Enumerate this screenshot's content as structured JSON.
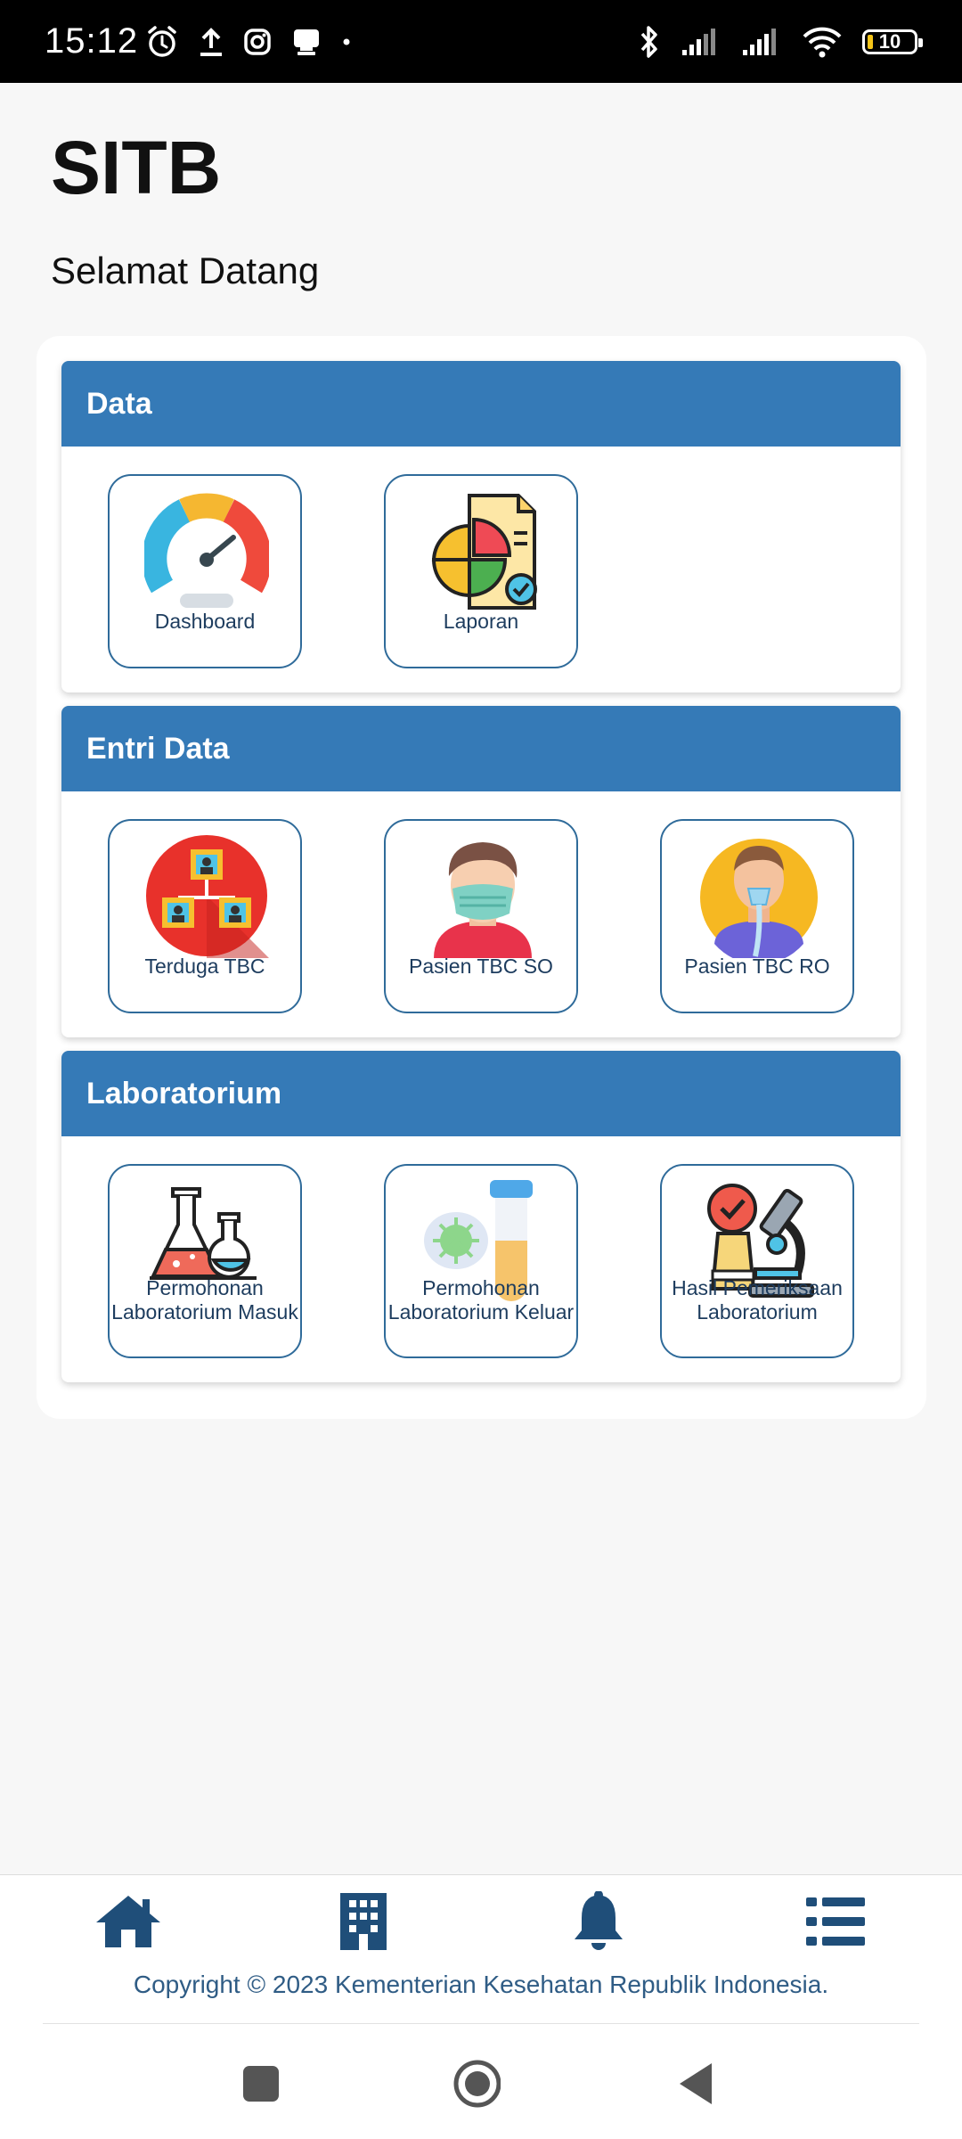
{
  "status_bar": {
    "time": "15:12",
    "battery_level": "10",
    "icons_left": [
      "alarm-icon",
      "upload-icon",
      "instagram-icon",
      "notification-icon",
      "dot-icon"
    ],
    "icons_right": [
      "bluetooth-icon",
      "signal-icon",
      "signal-icon",
      "wifi-icon",
      "battery-icon"
    ]
  },
  "header": {
    "title": "SITB",
    "welcome": "Selamat Datang"
  },
  "sections": [
    {
      "title": "Data",
      "items": [
        {
          "label": "Dashboard",
          "icon": "gauge-icon"
        },
        {
          "label": "Laporan",
          "icon": "report-chart-icon"
        }
      ]
    },
    {
      "title": "Entri Data",
      "items": [
        {
          "label": "Terduga TBC",
          "icon": "suspect-people-icon"
        },
        {
          "label": "Pasien TBC SO",
          "icon": "masked-patient-icon"
        },
        {
          "label": "Pasien TBC RO",
          "icon": "oxygen-patient-icon"
        }
      ]
    },
    {
      "title": "Laboratorium",
      "items": [
        {
          "label": "Permohonan Laboratorium Masuk",
          "icon": "lab-flask-icon"
        },
        {
          "label": "Permohonan Laboratorium Keluar",
          "icon": "test-tube-virus-icon"
        },
        {
          "label": "Hasil Pemeriksaan Laboratorium",
          "icon": "microscope-icon"
        }
      ]
    }
  ],
  "bottom_nav": {
    "items": [
      "home-icon",
      "building-icon",
      "bell-icon",
      "list-icon"
    ],
    "copyright": "Copyright © 2023 Kementerian Kesehatan Republik Indonesia."
  },
  "system_nav": [
    "recents-button",
    "home-button",
    "back-button"
  ],
  "colors": {
    "header_blue": "#357ab7",
    "nav_icon": "#1f4e79",
    "tile_border": "#2f6b9a"
  }
}
